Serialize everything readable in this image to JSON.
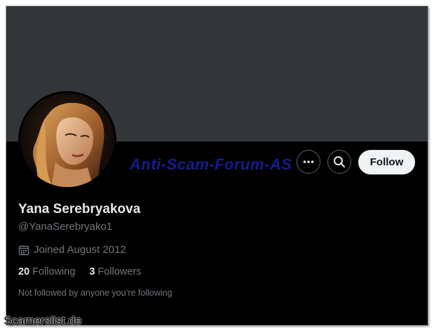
{
  "profile": {
    "name": "Yana Serebryakova",
    "handle": "@YanaSerebryako1",
    "joined": "Joined August 2012",
    "following_count": "20",
    "following_label": "Following",
    "followers_count": "3",
    "followers_label": "Followers",
    "not_followed_text": "Not followed by anyone you’re following"
  },
  "actions": {
    "more_icon": "more-horizontal-icon",
    "search_icon": "search-icon",
    "follow_label": "Follow"
  },
  "overlays": {
    "watermark": "Anti-Scam-Forum-AS",
    "site_label": "Scamerslist.de"
  },
  "colors": {
    "banner": "#333639",
    "background": "#000000",
    "primary_text": "#e7e9ea",
    "secondary_text": "#71767b",
    "follow_button": "#eff3f4",
    "watermark": "#141c8c"
  }
}
